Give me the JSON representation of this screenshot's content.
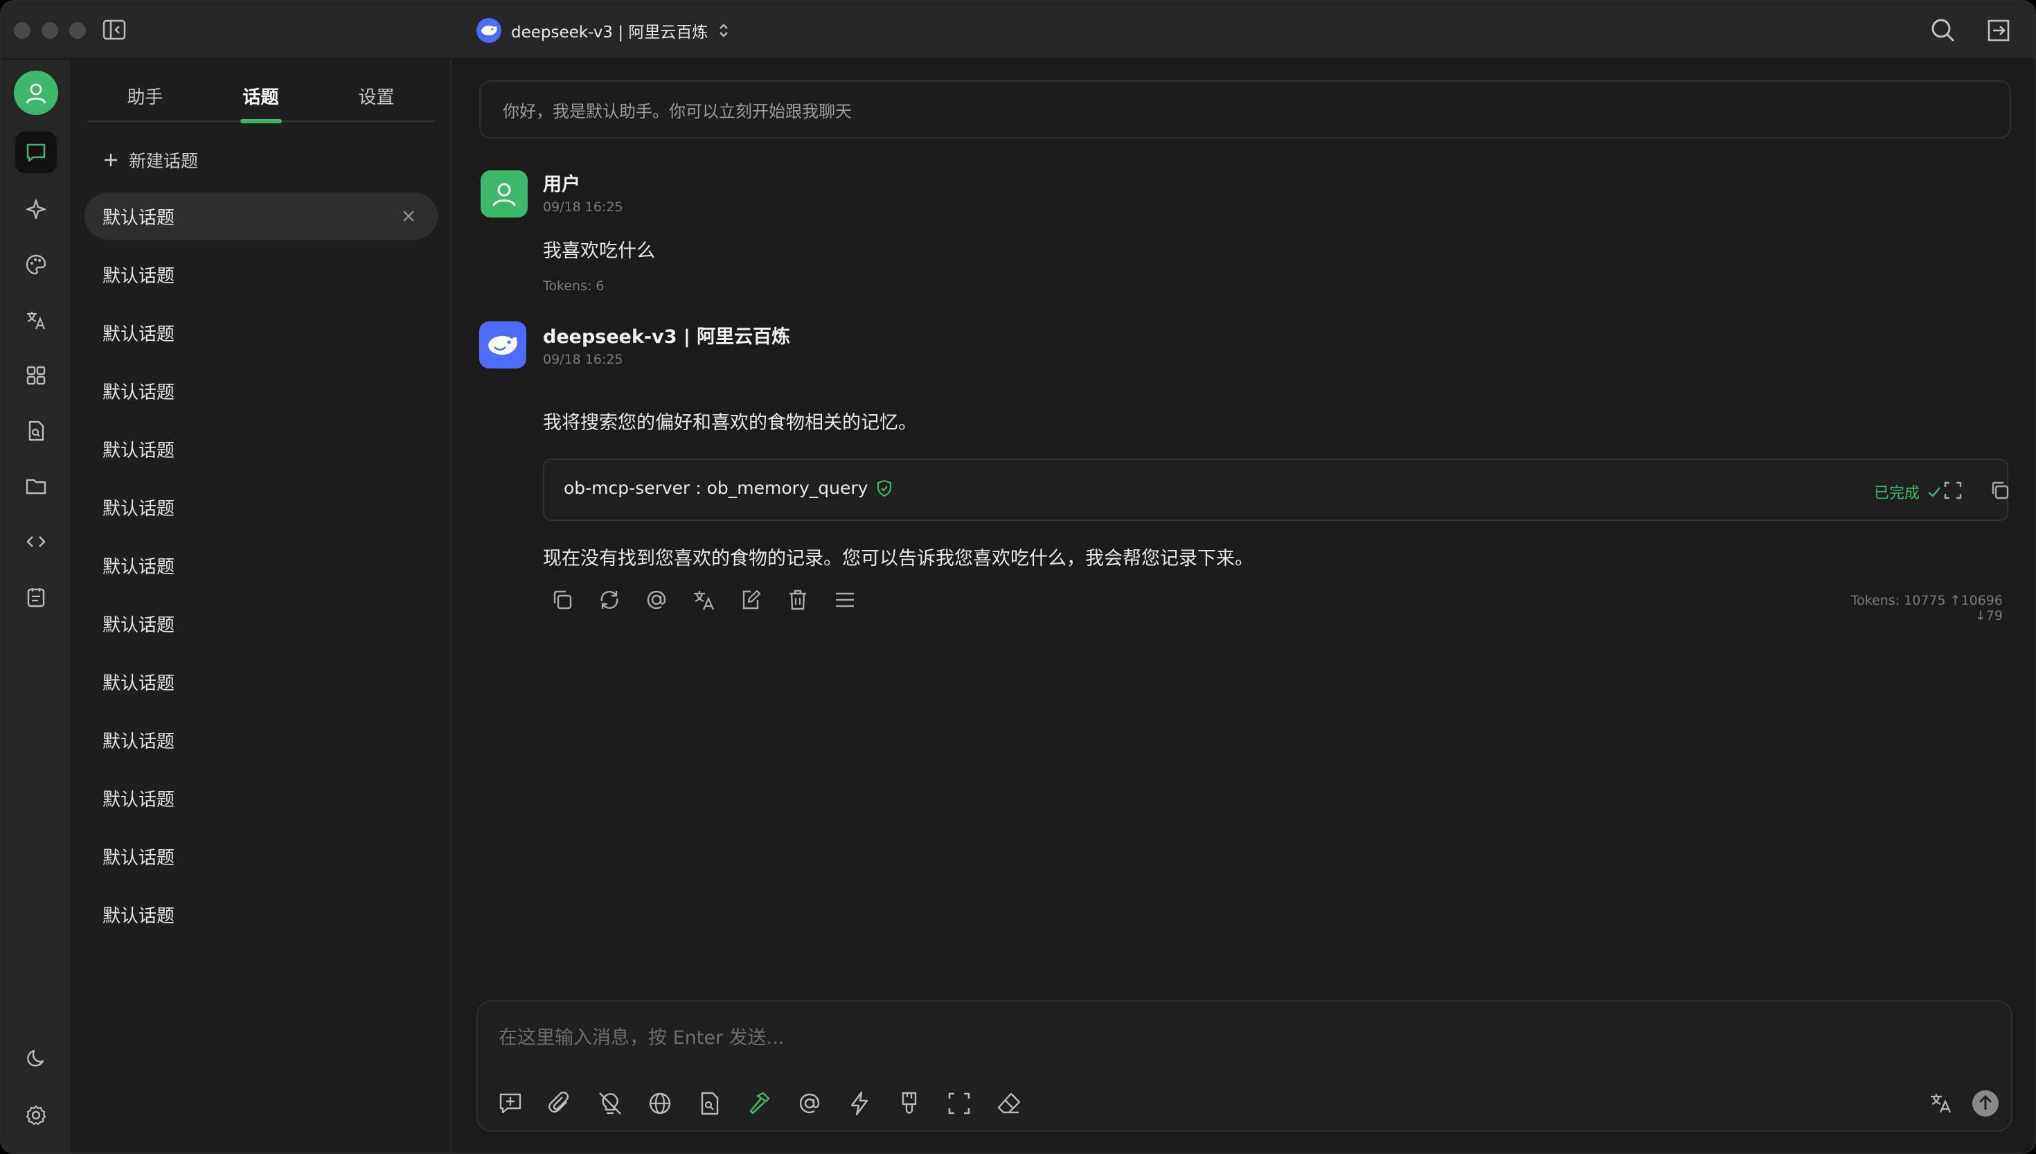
{
  "titlebar": {
    "model_name": "deepseek-v3 | 阿里云百炼"
  },
  "topics_panel": {
    "tabs": [
      {
        "label": "助手"
      },
      {
        "label": "话题"
      },
      {
        "label": "设置"
      }
    ],
    "active_tab": "话题",
    "new_topic_label": "新建话题",
    "topics": [
      {
        "label": "默认话题",
        "active": true
      },
      {
        "label": "默认话题"
      },
      {
        "label": "默认话题"
      },
      {
        "label": "默认话题"
      },
      {
        "label": "默认话题"
      },
      {
        "label": "默认话题"
      },
      {
        "label": "默认话题"
      },
      {
        "label": "默认话题"
      },
      {
        "label": "默认话题"
      },
      {
        "label": "默认话题"
      },
      {
        "label": "默认话题"
      },
      {
        "label": "默认话题"
      },
      {
        "label": "默认话题"
      }
    ]
  },
  "chat": {
    "welcome": "你好，我是默认助手。你可以立刻开始跟我聊天",
    "messages": [
      {
        "role": "user",
        "name": "用户",
        "time": "09/18 16:25",
        "text": "我喜欢吃什么",
        "tokens": "Tokens: 6"
      },
      {
        "role": "assistant",
        "name": "deepseek-v3 | 阿里云百炼",
        "time": "09/18 16:25",
        "text_before": "我将搜索您的偏好和喜欢的食物相关的记忆。",
        "tool": {
          "name": "ob-mcp-server : ob_memory_query",
          "status": "已完成"
        },
        "text_after": "现在没有找到您喜欢的食物的记录。您可以告诉我您喜欢吃什么，我会帮您记录下来。",
        "tokens": "Tokens: 10775 ↑10696 ↓79"
      }
    ]
  },
  "input": {
    "placeholder": "在这里输入消息，按 Enter 发送..."
  },
  "colors": {
    "accent": "#3db86b",
    "deepseek": "#4d6bfe",
    "background": "#1b1b1b",
    "sidebar": "#262626"
  }
}
